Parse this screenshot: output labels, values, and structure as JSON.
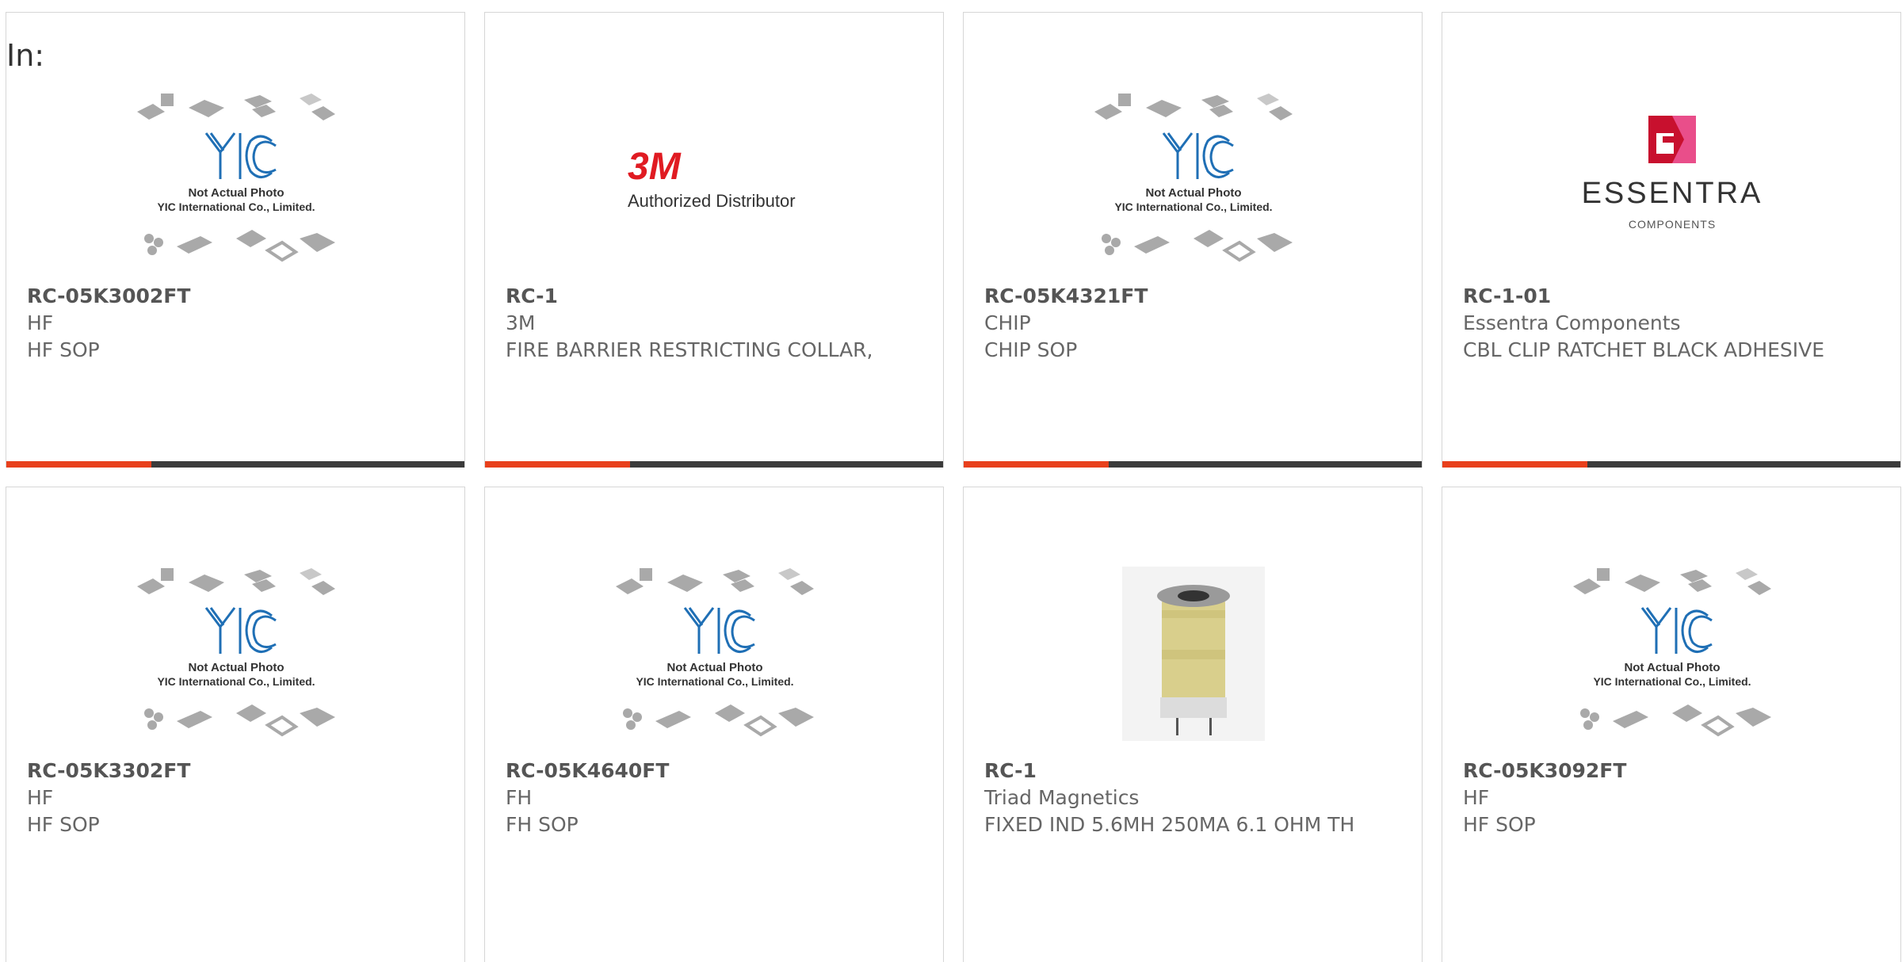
{
  "filter_label": "In:",
  "colors": {
    "accent": "#e8401c",
    "bar": "#3b3b3b",
    "yic_blue": "#1f6fb5"
  },
  "placeholder_photo": {
    "line1": "Not Actual Photo",
    "line2": "YIC International Co., Limited."
  },
  "logos": {
    "threem_mark": "3M",
    "threem_caption": "Authorized Distributor",
    "essentra_name": "ESSENTRA",
    "essentra_caption": "COMPONENTS"
  },
  "products": [
    {
      "part": "RC-05K3002FT",
      "manufacturer": "HF",
      "description": "HF SOP",
      "image": "yic-placeholder"
    },
    {
      "part": "RC-1",
      "manufacturer": "3M",
      "description": "FIRE BARRIER RESTRICTING COLLAR,",
      "image": "3m-logo"
    },
    {
      "part": "RC-05K4321FT",
      "manufacturer": "CHIP",
      "description": "CHIP SOP",
      "image": "yic-placeholder"
    },
    {
      "part": "RC-1-01",
      "manufacturer": "Essentra Components",
      "description": "CBL CLIP RATCHET BLACK ADHESIVE",
      "image": "essentra-logo"
    },
    {
      "part": "RC-05K3302FT",
      "manufacturer": "HF",
      "description": "HF SOP",
      "image": "yic-placeholder"
    },
    {
      "part": "RC-05K4640FT",
      "manufacturer": "FH",
      "description": "FH SOP",
      "image": "yic-placeholder"
    },
    {
      "part": "RC-1",
      "manufacturer": "Triad Magnetics",
      "description": "FIXED IND 5.6MH 250MA 6.1 OHM TH",
      "image": "inductor-photo"
    },
    {
      "part": "RC-05K3092FT",
      "manufacturer": "HF",
      "description": "HF SOP",
      "image": "yic-placeholder"
    }
  ]
}
